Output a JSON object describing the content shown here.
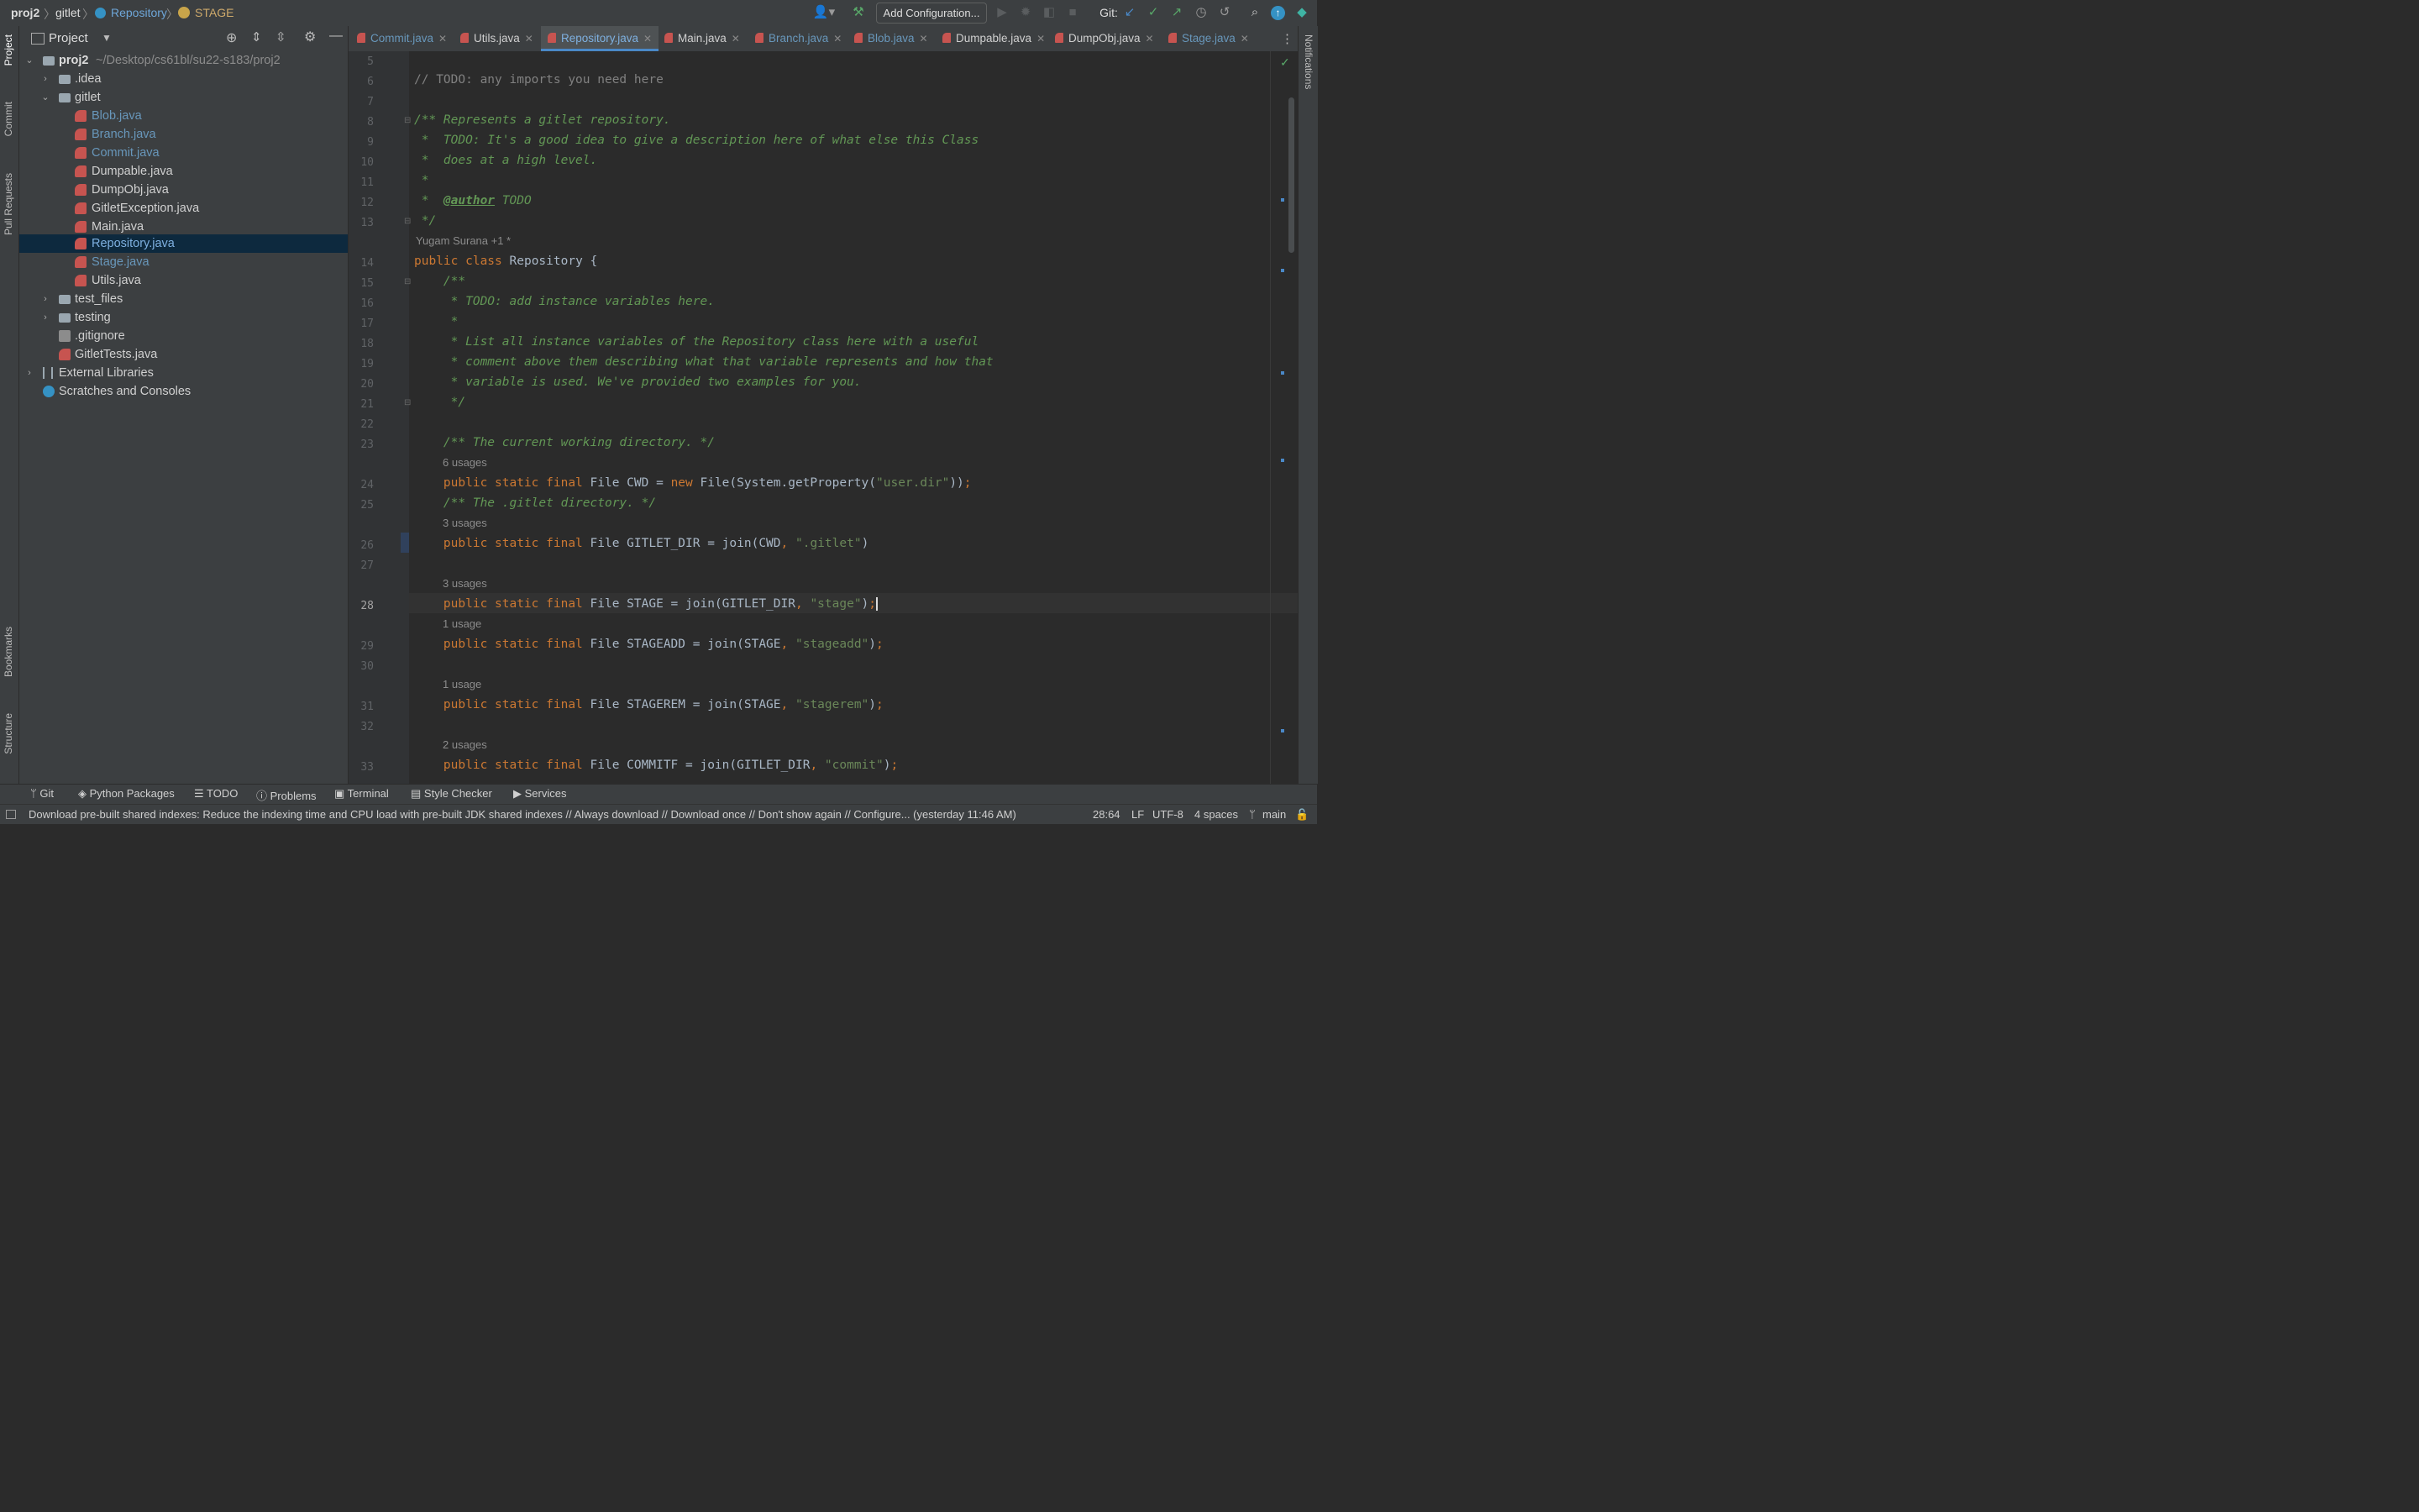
{
  "breadcrumbs": [
    "proj2",
    "gitlet",
    "Repository",
    "STAGE"
  ],
  "toolbar": {
    "add_configuration": "Add Configuration...",
    "git_label": "Git:"
  },
  "left_strip": [
    "Project",
    "Commit",
    "Pull Requests",
    "Bookmarks",
    "Structure"
  ],
  "right_strip": [
    "Notifications"
  ],
  "project_panel": {
    "title": "Project",
    "root": "proj2",
    "root_path": "~/Desktop/cs61bl/su22-s183/proj2",
    "items": [
      {
        "label": ".idea"
      },
      {
        "label": "gitlet"
      },
      {
        "label": "Blob.java"
      },
      {
        "label": "Branch.java"
      },
      {
        "label": "Commit.java"
      },
      {
        "label": "Dumpable.java"
      },
      {
        "label": "DumpObj.java"
      },
      {
        "label": "GitletException.java"
      },
      {
        "label": "Main.java"
      },
      {
        "label": "Repository.java"
      },
      {
        "label": "Stage.java"
      },
      {
        "label": "Utils.java"
      },
      {
        "label": "test_files"
      },
      {
        "label": "testing"
      },
      {
        "label": ".gitignore"
      },
      {
        "label": "GitletTests.java"
      },
      {
        "label": "External Libraries"
      },
      {
        "label": "Scratches and Consoles"
      }
    ]
  },
  "tabs": [
    "Commit.java",
    "Utils.java",
    "Repository.java",
    "Main.java",
    "Branch.java",
    "Blob.java",
    "Dumpable.java",
    "DumpObj.java",
    "Stage.java"
  ],
  "editor": {
    "lines": [
      "5",
      "6",
      "7",
      "8",
      "9",
      "10",
      "11",
      "12",
      "13",
      "14",
      "15",
      "16",
      "17",
      "18",
      "19",
      "20",
      "21",
      "22",
      "23",
      "24",
      "25",
      "26",
      "27",
      "28",
      "29",
      "30",
      "31",
      "32",
      "33"
    ],
    "author_hint": "Yugam Surana +1 *",
    "usages": [
      "6 usages",
      "3 usages",
      "3 usages",
      "1 usage",
      "1 usage",
      "2 usages"
    ]
  },
  "tool_windows": [
    "Git",
    "Python Packages",
    "TODO",
    "Problems",
    "Terminal",
    "Style Checker",
    "Services"
  ],
  "status": {
    "message": "Download pre-built shared indexes: Reduce the indexing time and CPU load with pre-built JDK shared indexes // Always download // Download once // Don't show again // Configure... (yesterday 11:46 AM)",
    "position": "28:64",
    "line_sep": "LF",
    "encoding": "UTF-8",
    "indent": "4 spaces",
    "branch": "main"
  }
}
